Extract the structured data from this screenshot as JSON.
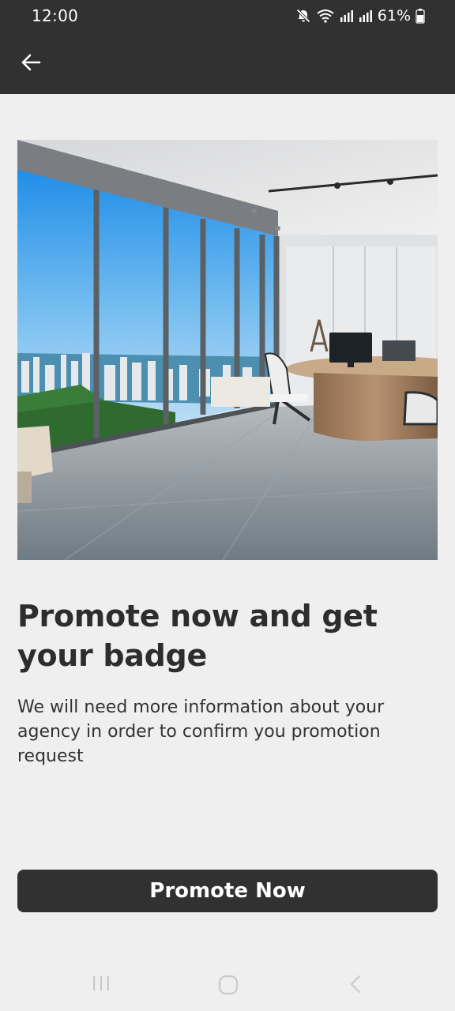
{
  "status_bar": {
    "time": "12:00",
    "battery_percent": "61%",
    "icons": [
      "mute-icon",
      "wifi-icon",
      "signal-icon",
      "signal-icon",
      "battery-icon"
    ]
  },
  "app_bar": {
    "back_icon": "arrow-left-icon"
  },
  "hero": {
    "subject": "office interior with city view"
  },
  "content": {
    "title": "Promote now and get your badge",
    "description": "We will need more information about your agency in order to confirm you promotion request"
  },
  "actions": {
    "promote_label": "Promote Now"
  },
  "nav_bar": {
    "icons": [
      "recent-apps-icon",
      "home-icon",
      "back-nav-icon"
    ]
  },
  "colors": {
    "bar": "#313131",
    "background": "#efefef",
    "title": "#2d2d2d",
    "button": "#313131"
  }
}
